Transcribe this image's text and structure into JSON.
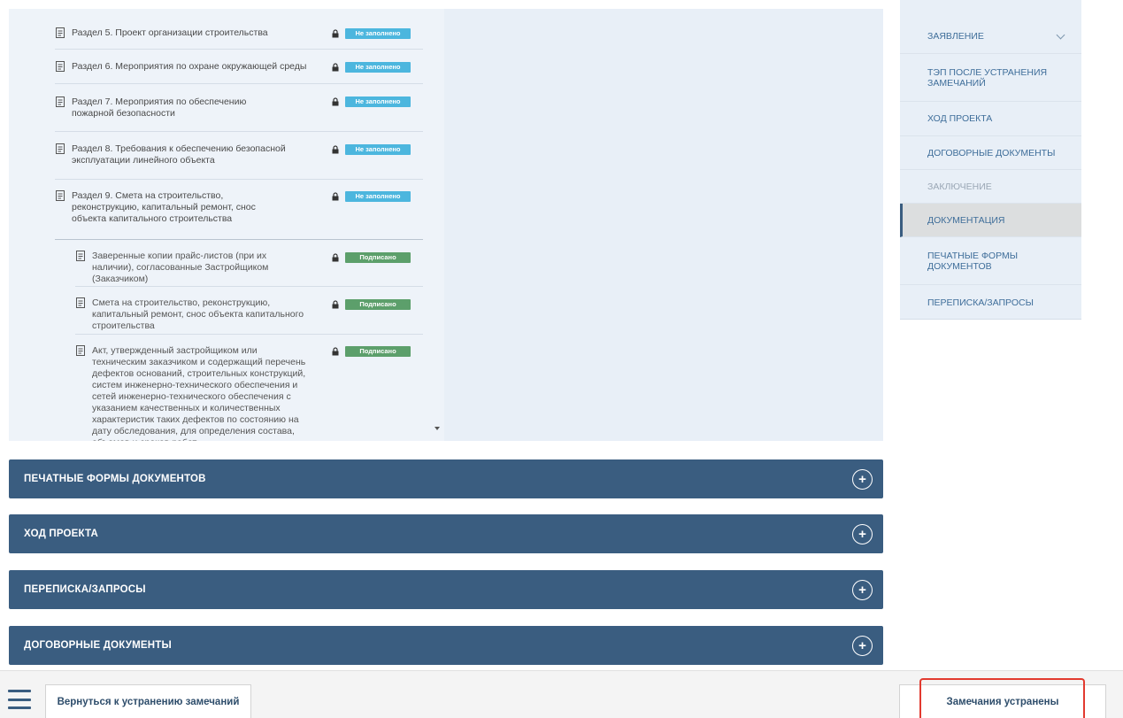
{
  "documents": {
    "items": [
      {
        "text": "Раздел 5. Проект организации строительства",
        "status": "Не заполнено"
      },
      {
        "text": "Раздел 6. Мероприятия по охране окружающей среды",
        "status": "Не заполнено"
      },
      {
        "text": "Раздел 7. Мероприятия по обеспечению пожарной безопасности",
        "status": "Не заполнено"
      },
      {
        "text": "Раздел 8. Требования к обеспечению безопасной эксплуатации линейного объекта",
        "status": "Не заполнено"
      },
      {
        "text": "Раздел 9. Смета на строительство, реконструкцию, капитальный ремонт, снос объекта капитального строительства",
        "status": "Не заполнено"
      }
    ],
    "subitems": [
      {
        "text": "Заверенные копии прайс-листов (при их наличии), согласованные Застройщиком (Заказчиком)",
        "status": "Подписано"
      },
      {
        "text": "Смета на строительство, реконструкцию, капитальный ремонт, снос объекта капитального строительства",
        "status": "Подписано"
      },
      {
        "text": "Акт, утвержденный застройщиком или техническим заказчиком и содержащий перечень дефектов оснований, строительных конструкций, систем инженерно-технического обеспечения и сетей инженерно-технического обеспечения с указанием качественных и количественных характеристик таких дефектов по состоянию на дату обследования, для определения состава, объемов и сроков работ",
        "status": "Подписано"
      }
    ]
  },
  "accordion": [
    {
      "title": "ПЕЧАТНЫЕ ФОРМЫ ДОКУМЕНТОВ",
      "icon": "plus-circle-icon"
    },
    {
      "title": "ХОД ПРОЕКТА",
      "icon": "plus-circle-icon"
    },
    {
      "title": "ПЕРЕПИСКА/ЗАПРОСЫ",
      "icon": "plus-circle-icon"
    },
    {
      "title": "ДОГОВОРНЫЕ ДОКУМЕНТЫ",
      "icon": "plus-circle-icon"
    }
  ],
  "nav": {
    "items": [
      {
        "label": "ЗАЯВЛЕНИЕ",
        "state": "normal",
        "has_chevron": true
      },
      {
        "label": "ТЭП ПОСЛЕ УСТРАНЕНИЯ ЗАМЕЧАНИЙ",
        "state": "normal"
      },
      {
        "label": "ХОД ПРОЕКТА",
        "state": "normal"
      },
      {
        "label": "ДОГОВОРНЫЕ ДОКУМЕНТЫ",
        "state": "normal"
      },
      {
        "label": "ЗАКЛЮЧЕНИЕ",
        "state": "disabled"
      },
      {
        "label": "ДОКУМЕНТАЦИЯ",
        "state": "active"
      },
      {
        "label": "ПЕЧАТНЫЕ ФОРМЫ ДОКУМЕНТОВ",
        "state": "normal"
      },
      {
        "label": "ПЕРЕПИСКА/ЗАПРОСЫ",
        "state": "normal"
      }
    ]
  },
  "footer": {
    "back_label": "Вернуться к устранению замечаний",
    "done_label": "Замечания устранены"
  },
  "colors": {
    "accent": "#3a5d80",
    "badge_empty": "#4cb6de",
    "badge_signed": "#5c9f6b",
    "highlight": "#e23a2f"
  }
}
